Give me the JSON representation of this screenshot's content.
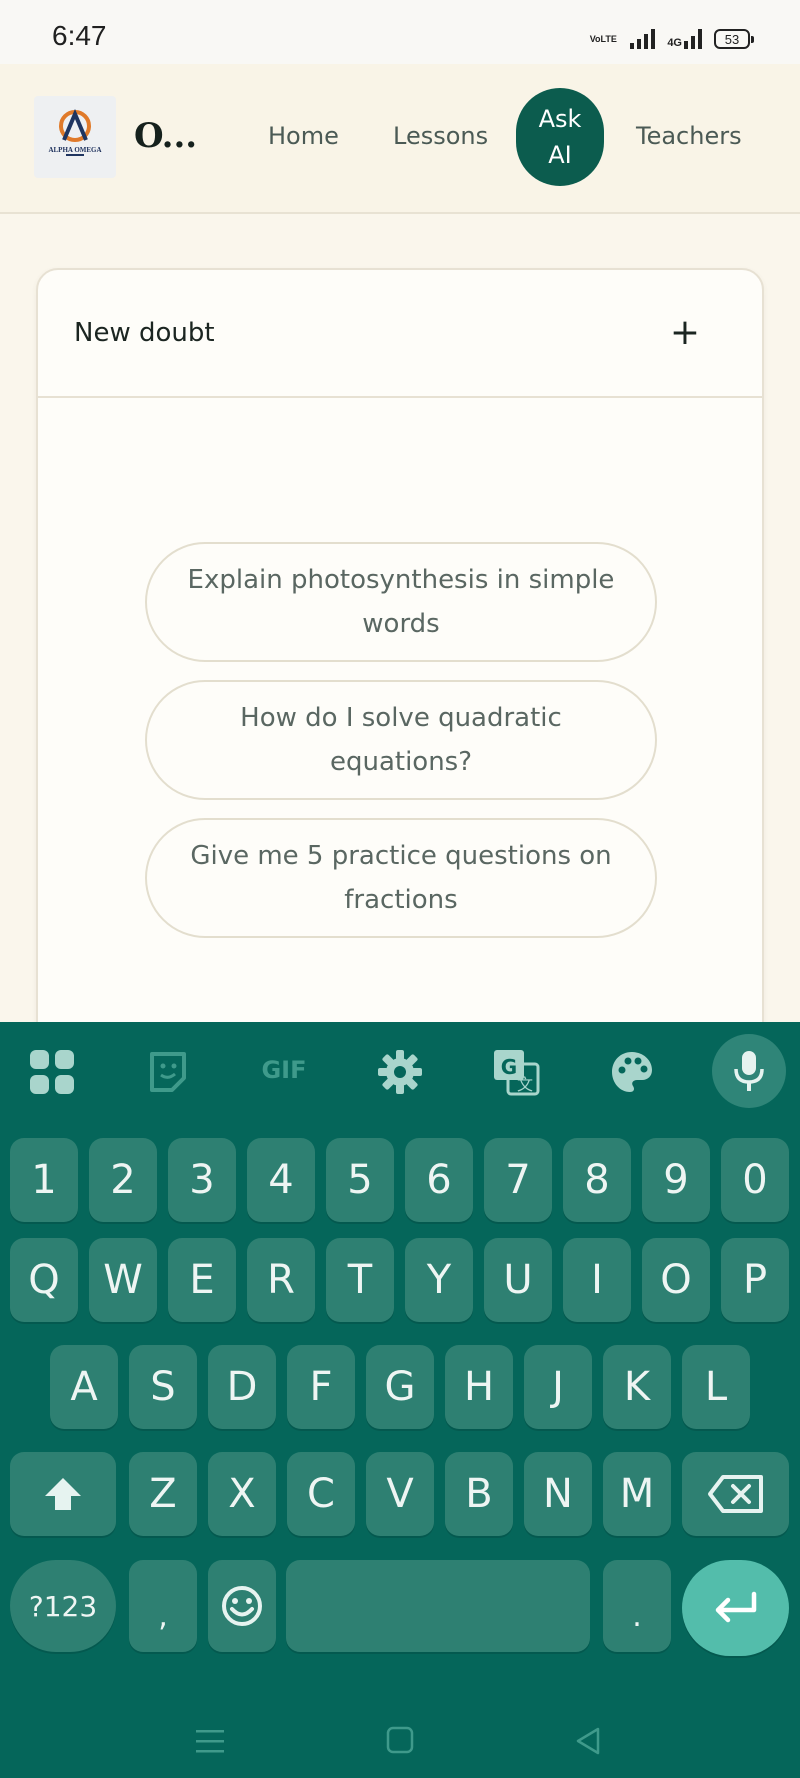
{
  "status_bar": {
    "time": "6:47",
    "volte_label": "VoLTE",
    "network_label": "4G",
    "battery": "53"
  },
  "header": {
    "logo_text": "ALPHA OMEGA",
    "brand": "O...",
    "nav": {
      "home": "Home",
      "lessons": "Lessons",
      "ask_ai": "Ask AI",
      "teachers": "Teachers"
    }
  },
  "chat": {
    "title": "New doubt",
    "new_icon": "+",
    "suggestions": [
      "Explain photosynthesis in simple words",
      "How do I solve quadratic equations?",
      "Give me 5 practice questions on fractions"
    ]
  },
  "keyboard": {
    "toolbar_icons": [
      "apps-grid-icon",
      "sticker-icon",
      "gif-icon",
      "settings-gear-icon",
      "translate-icon",
      "theme-palette-icon",
      "microphone-icon"
    ],
    "gif_label": "GIF",
    "row_numbers": [
      "1",
      "2",
      "3",
      "4",
      "5",
      "6",
      "7",
      "8",
      "9",
      "0"
    ],
    "row_top": [
      "Q",
      "W",
      "E",
      "R",
      "T",
      "Y",
      "U",
      "I",
      "O",
      "P"
    ],
    "row_middle": [
      "A",
      "S",
      "D",
      "F",
      "G",
      "H",
      "J",
      "K",
      "L"
    ],
    "row_bottom": [
      "Z",
      "X",
      "C",
      "V",
      "B",
      "N",
      "M"
    ],
    "symbols_label": "?123",
    "comma": ",",
    "period": ".",
    "accent_color": "#05665a",
    "key_color": "#2e8072",
    "enter_color": "#53bdab"
  }
}
